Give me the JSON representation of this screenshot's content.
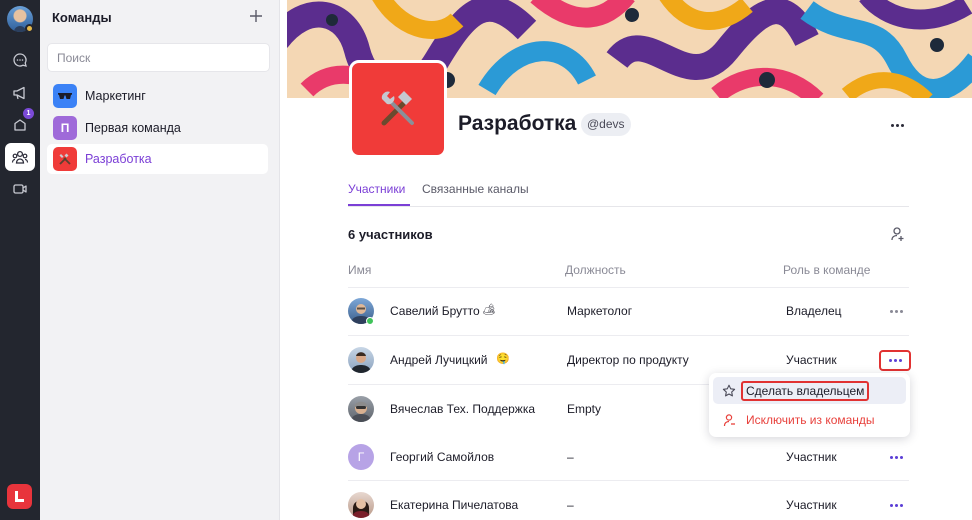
{
  "rail": {
    "notification_badge": "1",
    "items": [
      "chat-icon",
      "megaphone-icon",
      "notifications-icon",
      "teams-icon",
      "video-icon"
    ],
    "active": "teams-icon",
    "logo_letter": "L"
  },
  "panel": {
    "title": "Команды",
    "search_placeholder": "Поиск",
    "teams": [
      {
        "label": "Маркетинг",
        "avatar": "🕶",
        "color": "#3b82f6"
      },
      {
        "label": "Первая команда",
        "avatar": "П",
        "color": "#9f6ad9"
      },
      {
        "label": "Разработка",
        "avatar": "⚒",
        "color": "#f03b39",
        "active": true
      }
    ]
  },
  "team": {
    "name": "Разработка",
    "handle": "@devs",
    "avatar_emoji": "⚒",
    "tabs": [
      "Участники",
      "Связанные каналы"
    ],
    "active_tab": "Участники",
    "member_count": "6 участников"
  },
  "table": {
    "headers": {
      "name": "Имя",
      "position": "Должность",
      "role": "Роль в команде"
    },
    "rows": [
      {
        "name": "Савелий Брутто",
        "emoji": "🏕",
        "position": "Маркетолог",
        "role": "Владелец",
        "online": true
      },
      {
        "name": "Андрей Лучицкий",
        "emoji": "🤤",
        "position": "Директор по продукту",
        "role": "Участник"
      },
      {
        "name": "Вячеслав Тех. Поддержка",
        "emoji": "",
        "position": "Empty",
        "role": ""
      },
      {
        "name": "Георгий Самойлов",
        "emoji": "",
        "position": "–",
        "role": "Участник",
        "initial": "Г"
      },
      {
        "name": "Екатерина Пичелатова",
        "emoji": "",
        "position": "–",
        "role": "Участник"
      }
    ]
  },
  "menu": {
    "make_owner": "Сделать владельцем",
    "remove": "Исключить из команды"
  },
  "colors": {
    "accent": "#7b3fd6",
    "danger": "#e8413c",
    "highlight": "#e13232"
  }
}
